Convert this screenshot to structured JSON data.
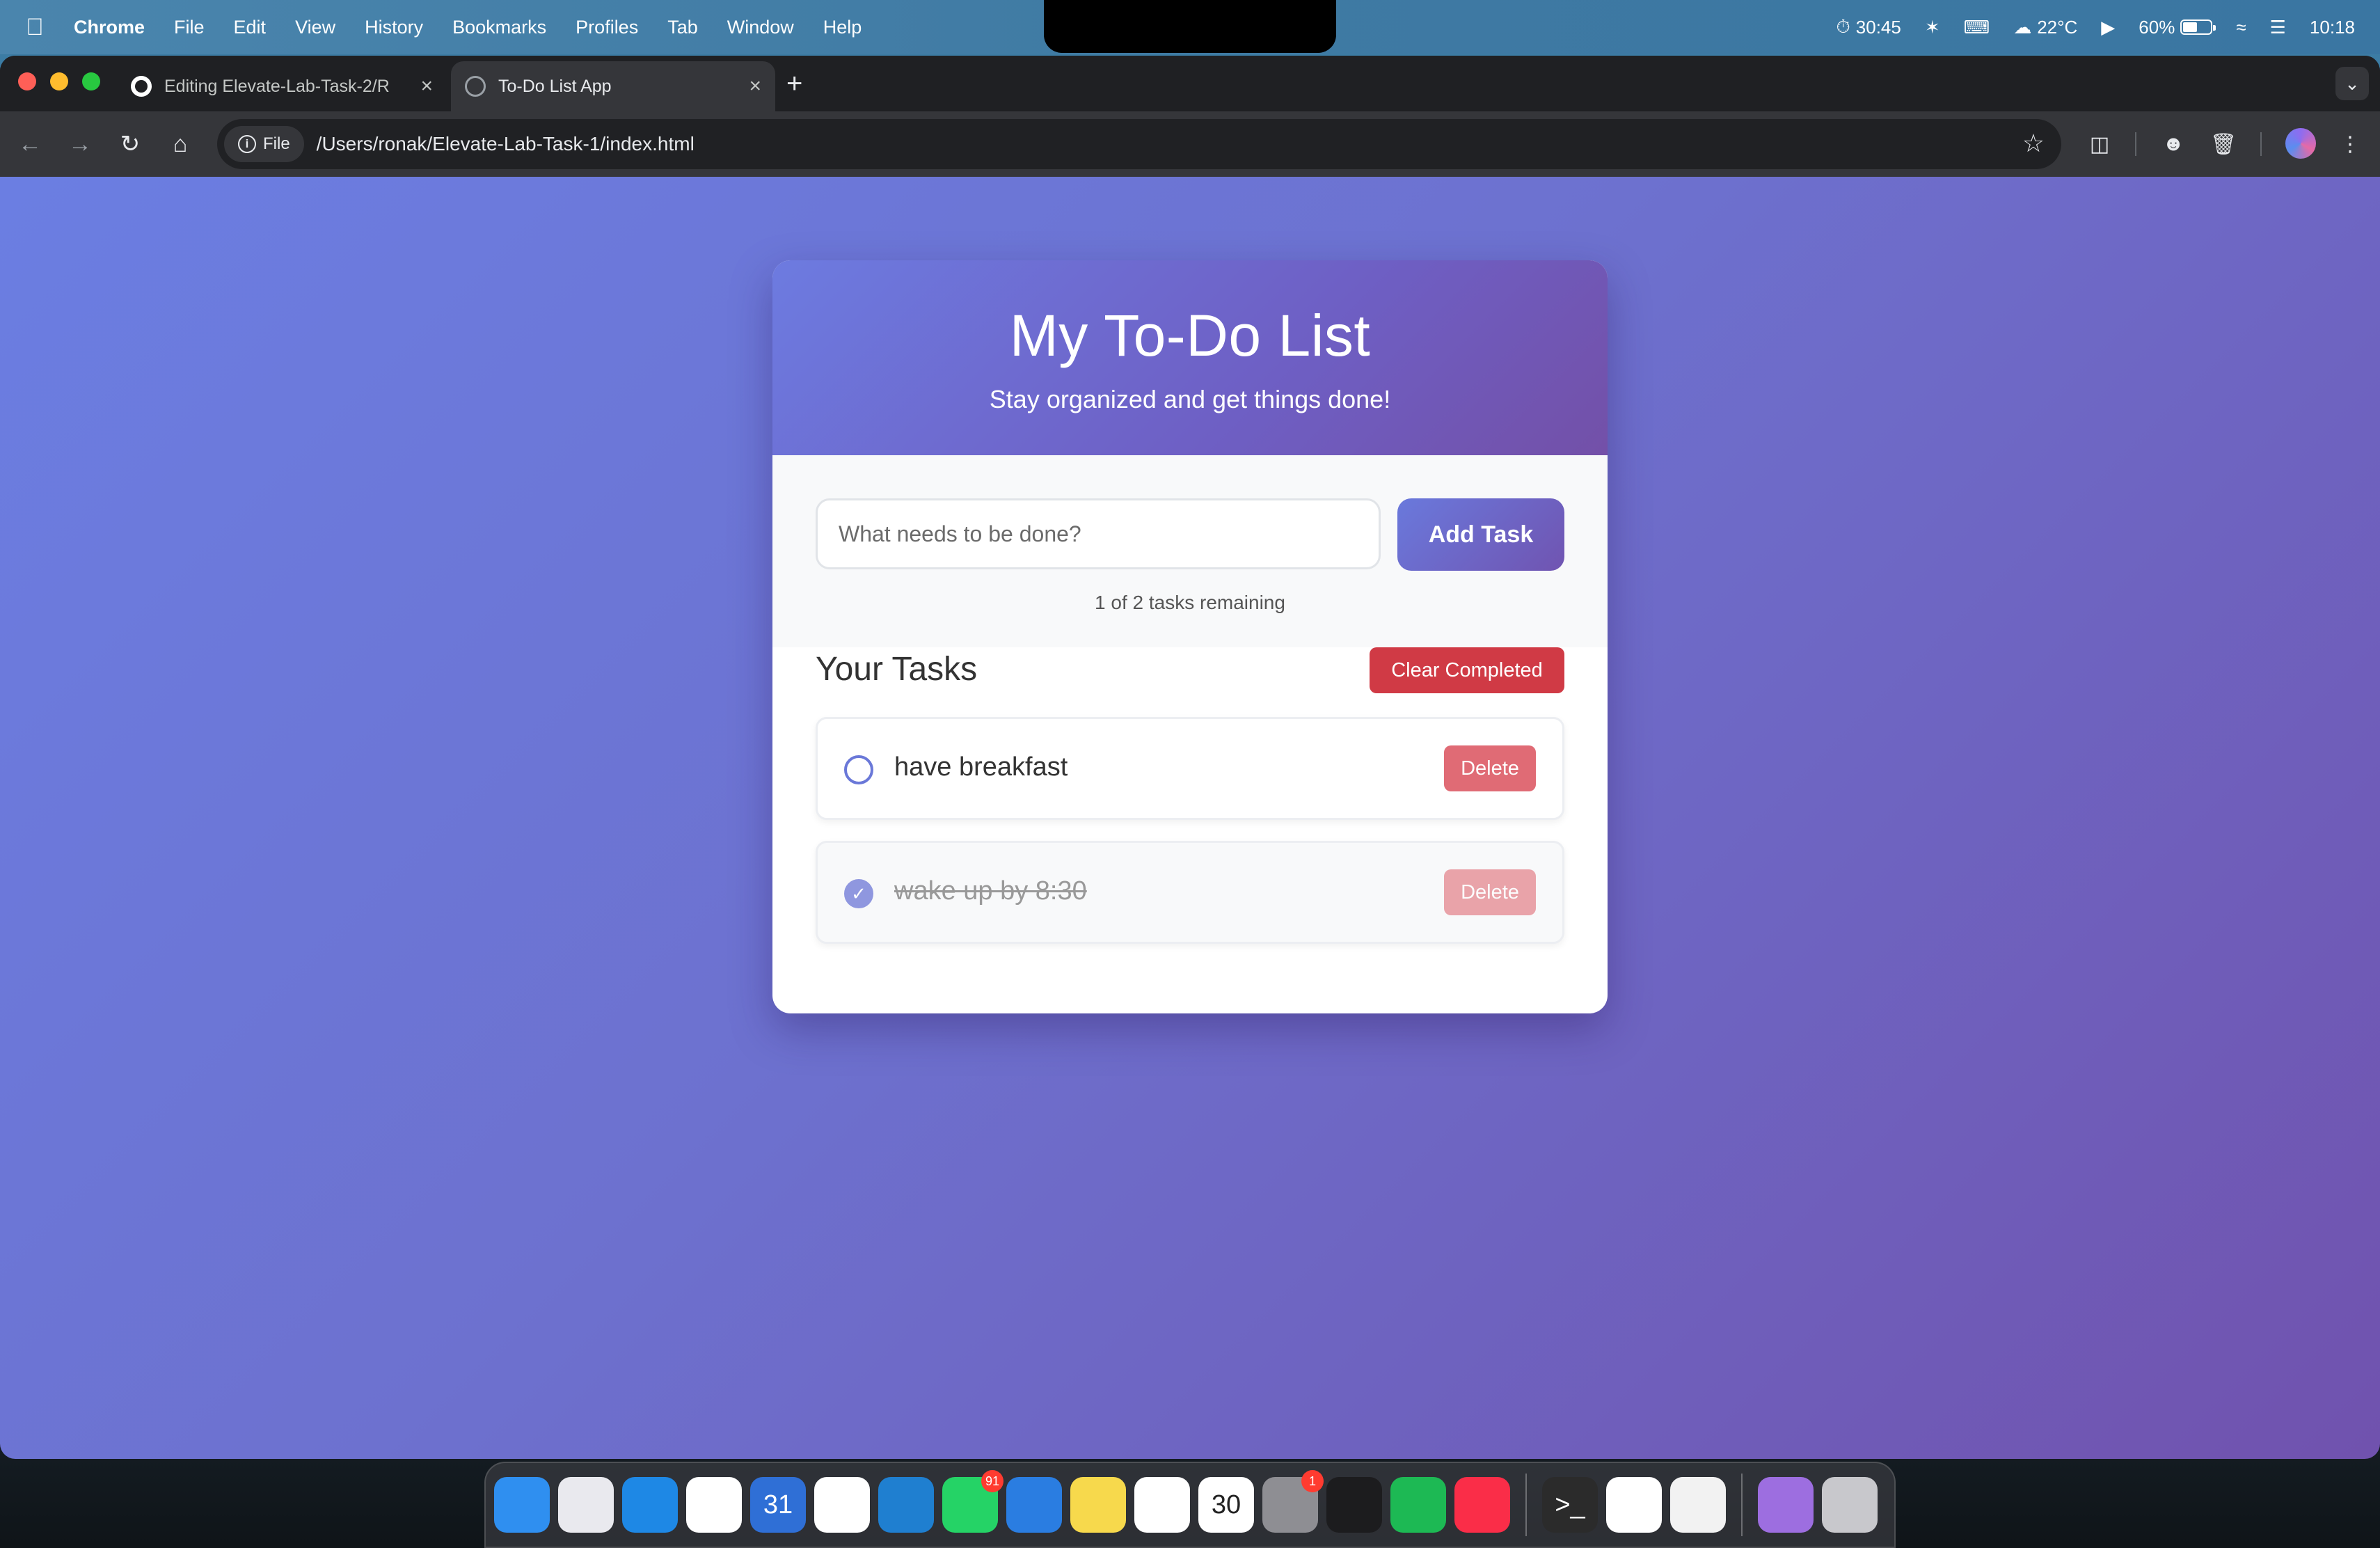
{
  "menubar": {
    "app_name": "Chrome",
    "items": [
      "File",
      "Edit",
      "View",
      "History",
      "Bookmarks",
      "Profiles",
      "Tab",
      "Window",
      "Help"
    ],
    "status": {
      "timer": "30:45",
      "weather": "22°C",
      "battery": "60%",
      "battery_level": 0.6,
      "clock": "10:18"
    }
  },
  "browser": {
    "tabs": [
      {
        "title": "Editing Elevate-Lab-Task-2/R",
        "icon": "github-icon"
      },
      {
        "title": "To-Do List App",
        "icon": "globe-icon"
      }
    ],
    "new_tab": "+",
    "omnibox": {
      "chip": "File",
      "url": "/Users/ronak/Elevate-Lab-Task-1/index.html"
    }
  },
  "app": {
    "title": "My To-Do List",
    "subtitle": "Stay organized and get things done!",
    "input_placeholder": "What needs to be done?",
    "add_button": "Add Task",
    "counter": "1 of 2 tasks remaining",
    "tasks_heading": "Your Tasks",
    "clear_button": "Clear Completed",
    "tasks": [
      {
        "text": "have breakfast",
        "completed": false,
        "delete_label": "Delete"
      },
      {
        "text": "wake up by 8:30",
        "completed": true,
        "delete_label": "Delete"
      }
    ]
  },
  "colors": {
    "accent": "#6a78d8",
    "header_gradient_end": "#7350a8",
    "danger": "#d03a45"
  },
  "dock": {
    "apps": [
      {
        "name": "finder-icon",
        "color": "#2f8ff0"
      },
      {
        "name": "launchpad-icon",
        "color": "#e9e9ee"
      },
      {
        "name": "safari-icon",
        "color": "#1e88e5"
      },
      {
        "name": "chrome-icon",
        "color": "#ffffff"
      },
      {
        "name": "calendar-icon",
        "color": "#2f6fd6",
        "label": "31"
      },
      {
        "name": "gmail-icon",
        "color": "#ffffff"
      },
      {
        "name": "vscode-icon",
        "color": "#1f7fd0"
      },
      {
        "name": "whatsapp-icon",
        "color": "#25d366",
        "badge": "91"
      },
      {
        "name": "tasks-icon",
        "color": "#2a7de1"
      },
      {
        "name": "notes-icon",
        "color": "#f7d94c"
      },
      {
        "name": "play-icon",
        "color": "#ffffff"
      },
      {
        "name": "calendar-date-icon",
        "color": "#ffffff",
        "label": "30"
      },
      {
        "name": "settings-icon",
        "color": "#8e8e93",
        "badge": "1"
      },
      {
        "name": "activity-monitor-icon",
        "color": "#1c1c1e"
      },
      {
        "name": "spotify-icon",
        "color": "#1db954"
      },
      {
        "name": "music-icon",
        "color": "#fa2d48"
      },
      {
        "name": "terminal-icon",
        "color": "#2b2b2b",
        "label": ">_"
      },
      {
        "name": "chatgpt-icon",
        "color": "#ffffff"
      },
      {
        "name": "clock-icon",
        "color": "#f2f2f2"
      },
      {
        "name": "folder-icon",
        "color": "#9d6ee0"
      },
      {
        "name": "trash-icon",
        "color": "#c8c8cc"
      }
    ]
  }
}
